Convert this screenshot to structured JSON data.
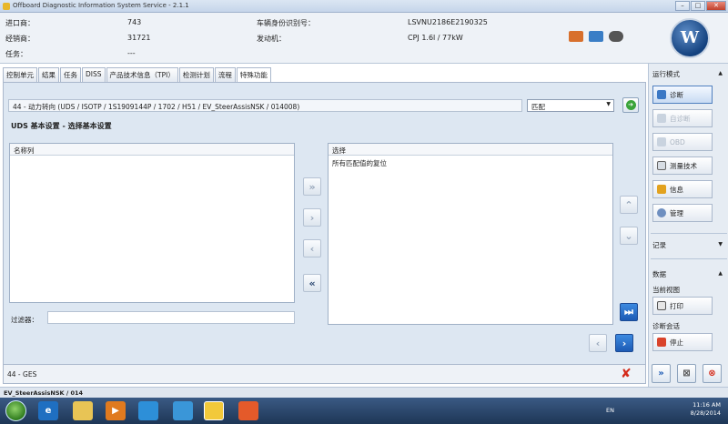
{
  "window": {
    "title": "Offboard Diagnostic Information System Service - 2.1.1"
  },
  "vehicle": {
    "importer_label": "进口商：",
    "importer_value": "743",
    "dealer_label": "经销商：",
    "dealer_value": "31721",
    "task_label": "任务：",
    "task_value": "---",
    "vin_label": "车辆身份识别号：",
    "vin_value": "LSVNU2186E2190325",
    "engine_label": "发动机：",
    "engine_value": "CPJ 1.6l / 77kW"
  },
  "tabs": [
    {
      "label": "控制单元"
    },
    {
      "label": "结果"
    },
    {
      "label": "任务"
    },
    {
      "label": "DISS"
    },
    {
      "label": "产品技术信息（TPI）"
    },
    {
      "label": "检测计划"
    },
    {
      "label": "流程"
    },
    {
      "label": "特殊功能"
    }
  ],
  "path": {
    "text": "44 - 动力转向  (UDS / ISOTP / 1S1909144P  / 1702 / H51 / EV_SteerAssisNSK / 014008)"
  },
  "match_dropdown": {
    "value": "匹配"
  },
  "section_title": "UDS 基本设置 - 选择基本设置",
  "left_panel": {
    "header": "名称列"
  },
  "right_panel": {
    "header": "选择",
    "items": [
      "所有匹配值的复位"
    ]
  },
  "filter": {
    "label": "过滤器："
  },
  "status": {
    "text": "44 - GES"
  },
  "footer": {
    "text": "EV_SteerAssisNSK / 014"
  },
  "sidebar": {
    "mode_header": "运行模式",
    "buttons": [
      {
        "label": "诊断"
      },
      {
        "label": "自诊断"
      },
      {
        "label": "OBD"
      },
      {
        "label": "测量技术"
      },
      {
        "label": "信息"
      },
      {
        "label": "管理"
      }
    ],
    "record_header": "记录",
    "data_header": "数据",
    "current_view": "当前视图",
    "print_label": "打印",
    "session_label": "诊断会话",
    "stop_label": "停止"
  },
  "taskbar": {
    "lang": "EN",
    "time": "11:16 AM",
    "date": "8/28/2014"
  },
  "colors": {
    "accent_blue": "#1c5ab4",
    "panel_bg": "#dde7f2",
    "go_green": "#3aa43a",
    "close_red": "#d42a1a"
  }
}
